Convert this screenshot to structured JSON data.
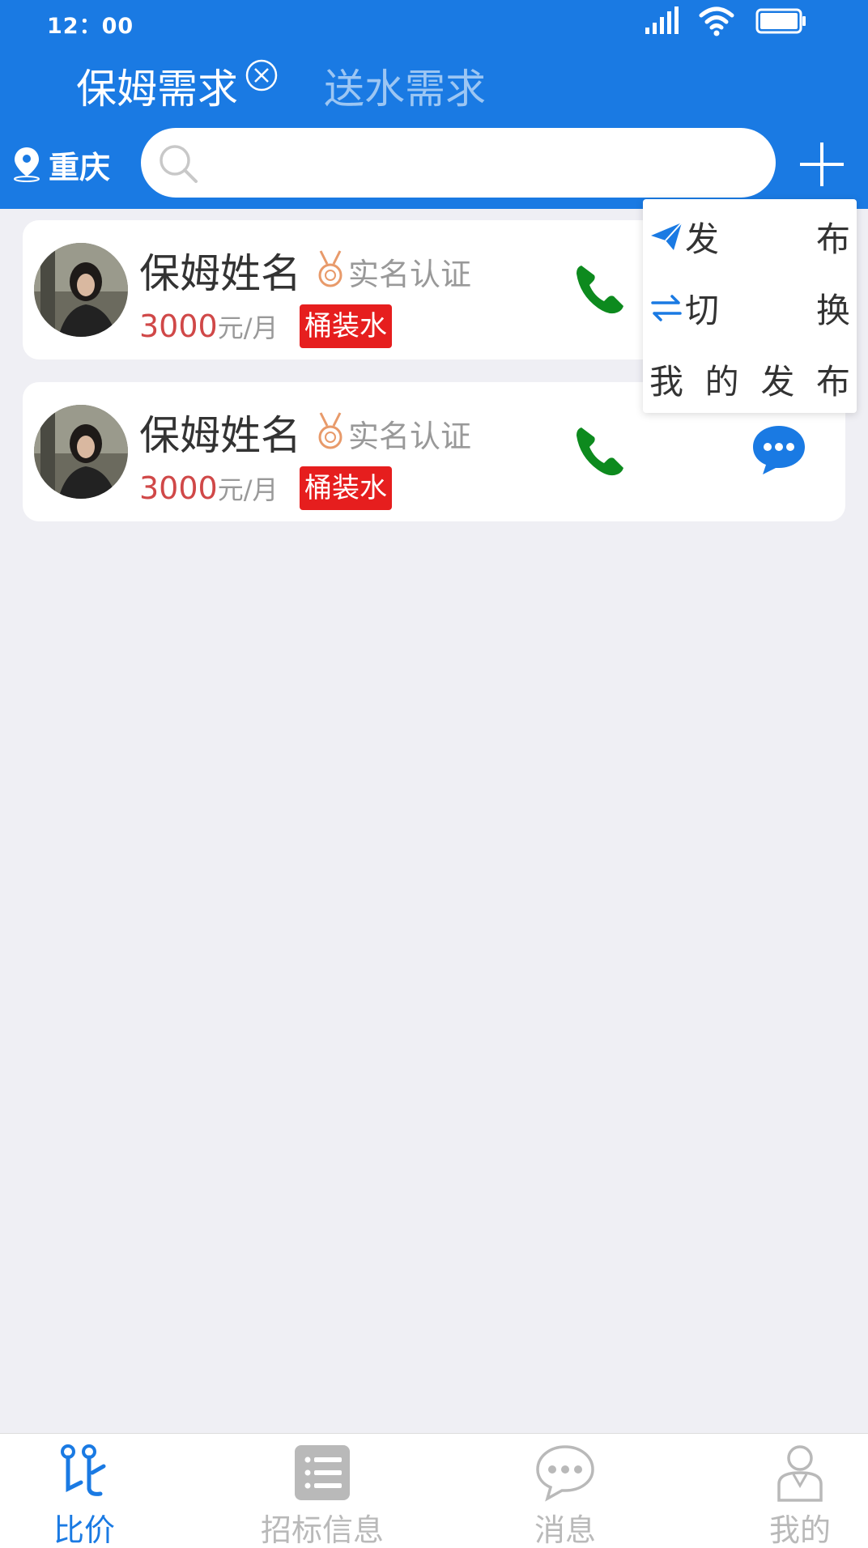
{
  "status_bar": {
    "time": "12：00"
  },
  "header": {
    "tabs": [
      {
        "label": "保姆需求",
        "active": true
      },
      {
        "label": "送水需求",
        "active": false
      }
    ],
    "location": "重庆",
    "search": {
      "placeholder": "",
      "value": ""
    }
  },
  "listings": [
    {
      "name": "保姆姓名",
      "verify": "实名认证",
      "price": "3000",
      "unit": "元/月",
      "tag": "桶装水"
    },
    {
      "name": "保姆姓名",
      "verify": "实名认证",
      "price": "3000",
      "unit": "元/月",
      "tag": "桶装水"
    }
  ],
  "dropdown": {
    "items": [
      {
        "label_1": "发",
        "label_2": "布",
        "icon": "send-icon"
      },
      {
        "label_1": "切",
        "label_2": "换",
        "icon": "swap-icon"
      },
      {
        "label_1": "我",
        "label_2": "的",
        "label_3": "发",
        "label_4": "布"
      }
    ]
  },
  "tab_bar": {
    "items": [
      {
        "label": "比价",
        "icon": "compare-icon",
        "active": true
      },
      {
        "label": "招标信息",
        "icon": "list-icon",
        "active": false
      },
      {
        "label": "消息",
        "icon": "message-icon",
        "active": false
      },
      {
        "label": "我的",
        "icon": "user-icon",
        "active": false
      }
    ]
  },
  "colors": {
    "primary": "#1a7ae3",
    "background": "#efeff4",
    "tag": "#e61e1e",
    "price": "#d04848",
    "phone": "#0d8a1e"
  }
}
